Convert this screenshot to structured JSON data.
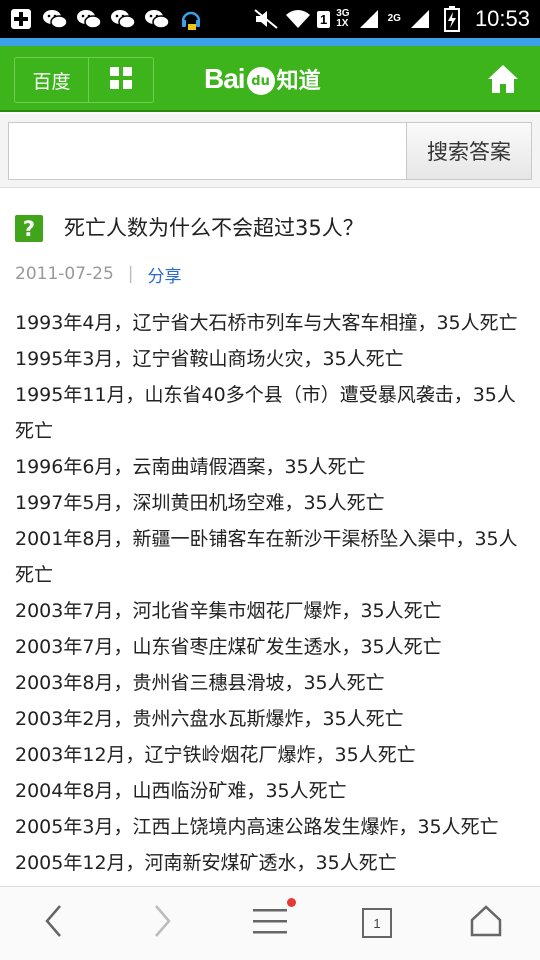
{
  "status_bar": {
    "time": "10:53",
    "sim_indicator": "1",
    "network_3g": "3G",
    "network_1x": "1X",
    "network_2g": "2G",
    "icons": [
      "add-icon",
      "wechat-icon",
      "wechat-icon",
      "wechat-icon",
      "wechat-icon",
      "headset-icon",
      "mute-icon",
      "wifi-icon",
      "signal-icon",
      "battery-icon"
    ]
  },
  "header": {
    "baidu_button": "百度",
    "logo_text": "Bai",
    "logo_du": "du",
    "logo_suffix": "知道"
  },
  "search": {
    "value": "",
    "placeholder": "",
    "button_label": "搜索答案"
  },
  "question": {
    "icon_char": "?",
    "title": "死亡人数为什么不会超过35人？",
    "date": "2011-07-25",
    "separator": "|",
    "share_label": "分享"
  },
  "content": {
    "lines": [
      "1993年4月，辽宁省大石桥市列车与大客车相撞，35人死亡",
      "1995年3月，辽宁省鞍山商场火灾，35人死亡",
      "1995年11月，山东省40多个县（市）遭受暴风袭击，35人死亡",
      "1996年6月，云南曲靖假酒案，35人死亡",
      "1997年5月，深圳黄田机场空难，35人死亡",
      "2001年8月，新疆一卧铺客车在新沙干渠桥坠入渠中，35人死亡",
      "2003年7月，河北省辛集市烟花厂爆炸，35人死亡",
      "2003年7月，山东省枣庄煤矿发生透水，35人死亡",
      "2003年8月，贵州省三穗县滑坡，35人死亡",
      "2003年2月，贵州六盘水瓦斯爆炸，35人死亡",
      "2003年12月，辽宁铁岭烟花厂爆炸，35人死亡",
      "2004年8月，山西临汾矿难，35人死亡",
      "2005年3月，江西上饶境内高速公路发生爆炸，35人死亡",
      "2005年12月，河南新安煤矿透水，35人死亡"
    ]
  },
  "bottom_nav": {
    "tab_count": "1",
    "items": [
      "back-icon",
      "forward-icon",
      "menu-icon",
      "tabs-icon",
      "home-icon"
    ]
  },
  "colors": {
    "header_green": "#3db31c",
    "accent_blue": "#3aa0e8",
    "link_blue": "#2a6ad0",
    "notification_red": "#e53935"
  }
}
